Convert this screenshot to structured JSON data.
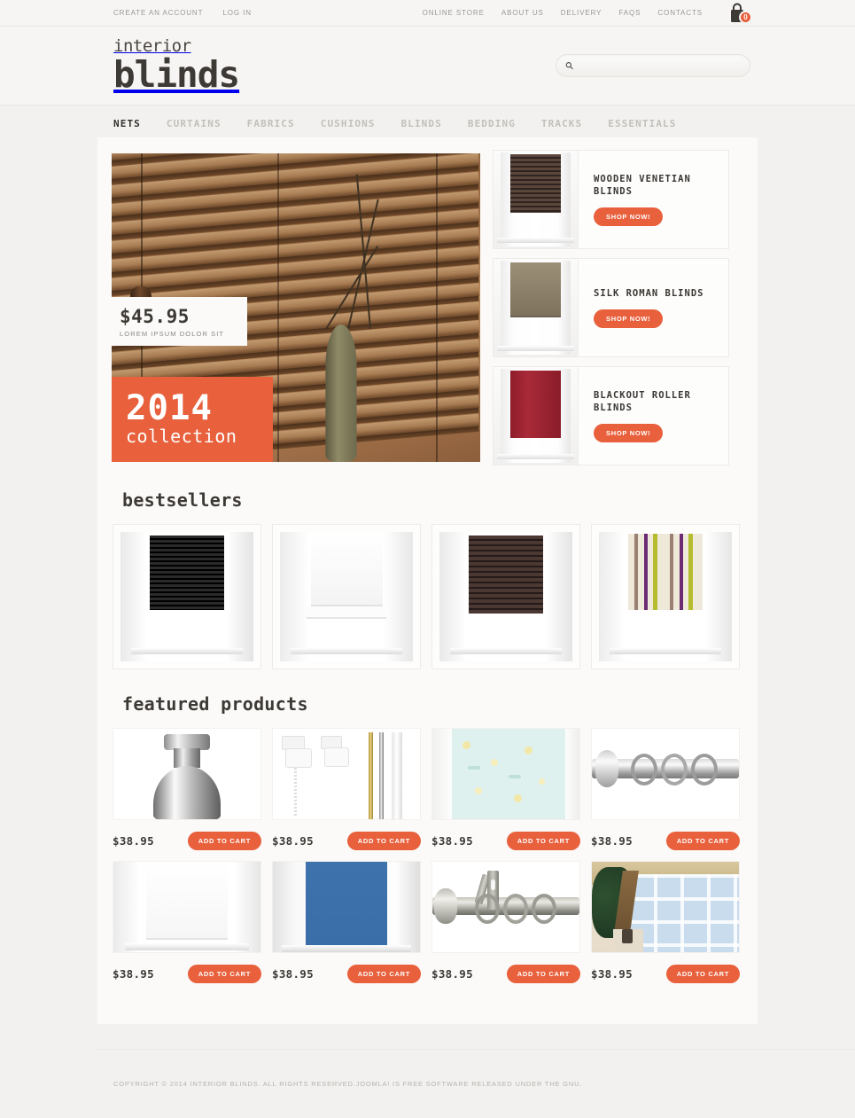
{
  "topbar": {
    "left_links": [
      {
        "label": "CREATE AN ACCOUNT",
        "name": "create-account-link"
      },
      {
        "label": "LOG IN",
        "name": "log-in-link"
      }
    ],
    "right_links": [
      {
        "label": "ONLINE STORE",
        "name": "online-store-link"
      },
      {
        "label": "ABOUT US",
        "name": "about-us-link"
      },
      {
        "label": "DELIVERY",
        "name": "delivery-link"
      },
      {
        "label": "FAQS",
        "name": "faqs-link"
      },
      {
        "label": "CONTACTS",
        "name": "contacts-link"
      }
    ],
    "cart_count": "0",
    "cart_icon": "shopping-bag-icon"
  },
  "header": {
    "logo_top": "interior",
    "logo_main": "blinds",
    "search": {
      "value": "",
      "placeholder": "",
      "icon": "search-icon"
    }
  },
  "nav": {
    "items": [
      {
        "label": "NETS",
        "active": true
      },
      {
        "label": "CURTAINS",
        "active": false
      },
      {
        "label": "FABRICS",
        "active": false
      },
      {
        "label": "CUSHIONS",
        "active": false
      },
      {
        "label": "BLINDS",
        "active": false
      },
      {
        "label": "BEDDING",
        "active": false
      },
      {
        "label": "TRACKS",
        "active": false
      },
      {
        "label": "ESSENTIALS",
        "active": false
      }
    ]
  },
  "hero": {
    "price": "$45.95",
    "subtitle": "LOREM IPSUM DOLOR SIT",
    "year": "2014",
    "collection": "collection",
    "image_alt": "wooden-venetian-blinds-with-vase"
  },
  "promos": [
    {
      "title": "WOODEN VENETIAN BLINDS",
      "button": "SHOP NOW!",
      "shade_color": "#4a3a31",
      "style": "venetian-dark-wood"
    },
    {
      "title": "SILK ROMAN BLINDS",
      "button": "SHOP NOW!",
      "shade_color": "#8a7d67",
      "style": "roman-taupe"
    },
    {
      "title": "BLACKOUT ROLLER BLINDS",
      "button": "SHOP NOW!",
      "shade_color": "#9e2230",
      "style": "roller-red"
    }
  ],
  "bestsellers": {
    "title": "bestsellers",
    "items": [
      {
        "name": "black-venetian-blind",
        "shade_color": "#121212",
        "style": "venetian"
      },
      {
        "name": "white-roman-blind",
        "shade_color": "#fbfbfb",
        "style": "roman"
      },
      {
        "name": "dark-wood-venetian-blind",
        "shade_color": "#3a2b28",
        "style": "venetian"
      },
      {
        "name": "striped-roman-blind",
        "shade_color": "#e8e2d2",
        "style": "striped-roman"
      }
    ]
  },
  "featured": {
    "title": "featured products",
    "add_to_cart_label": "ADD TO CART",
    "items": [
      {
        "name": "chrome-finial",
        "price": "$38.95",
        "style": "finial"
      },
      {
        "name": "curtain-track-brackets",
        "price": "$38.95",
        "style": "brackets"
      },
      {
        "name": "floral-patterned-blind",
        "price": "$38.95",
        "style": "floral"
      },
      {
        "name": "steel-curtain-pole-rings",
        "price": "$38.95",
        "style": "pole"
      },
      {
        "name": "white-roller-blind",
        "price": "$38.95",
        "style": "white-roller"
      },
      {
        "name": "blue-roller-blind",
        "price": "$38.95",
        "style": "blue-roller"
      },
      {
        "name": "pewter-curtain-pole",
        "price": "$38.95",
        "style": "pole2"
      },
      {
        "name": "conservatory-pleated-blinds",
        "price": "$38.95",
        "style": "conservatory"
      }
    ]
  },
  "footer": {
    "copyright": "COPYRIGHT © 2014 INTERIOR BLINDS. ALL RIGHTS RESERVED.JOOMLA! IS FREE SOFTWARE RELEASED UNDER THE GNU."
  },
  "colors": {
    "accent": "#e8603c",
    "page_bg": "#f2f1ef",
    "panel_bg": "#fbfaf9",
    "text_dark": "#3d3935"
  }
}
